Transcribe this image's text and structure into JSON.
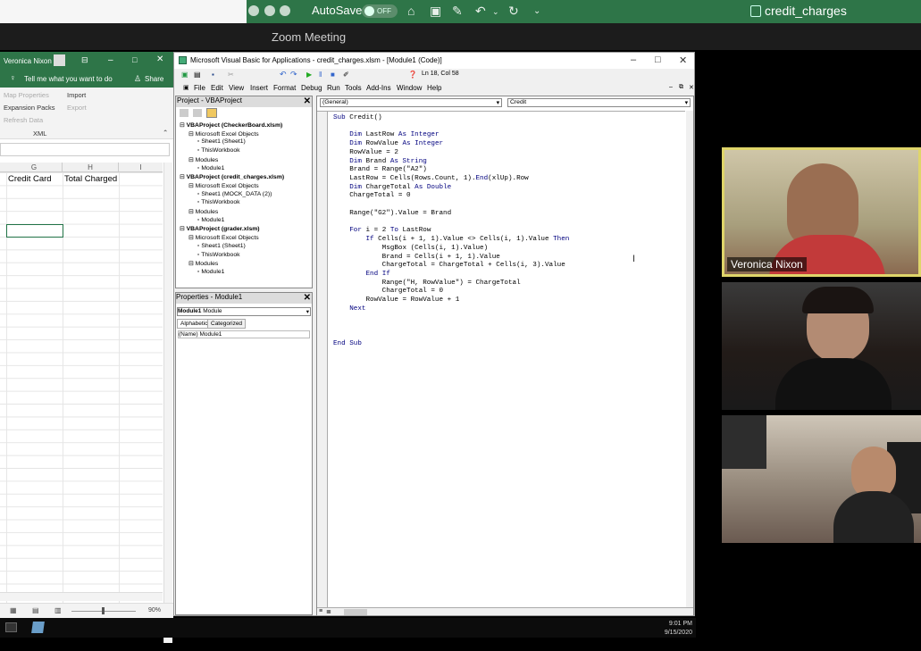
{
  "mac_titlebar": {
    "autosave_label": "AutoSave",
    "autosave_state": "OFF",
    "document_title": "credit_charges",
    "icons": [
      "home-icon",
      "save-icon",
      "edit-icon",
      "undo-icon",
      "chevron-down-icon",
      "redo-icon",
      "more-icon"
    ]
  },
  "zoom": {
    "window_title": "Zoom Meeting"
  },
  "excel": {
    "user_name": "Veronica Nixon",
    "search_hint": "Tell me what you want to do",
    "share_label": "Share",
    "ribbon": {
      "map_properties": "Map Properties",
      "import": "Import",
      "expansion_packs": "Expansion Packs",
      "export": "Export",
      "refresh_data": "Refresh Data",
      "group_label": "XML"
    },
    "columns": [
      "G",
      "H",
      "I"
    ],
    "cells": {
      "g1": "Credit Card",
      "h1": "Total Charged"
    },
    "zoom_level": "90%"
  },
  "vba": {
    "title": "Microsoft Visual Basic for Applications - credit_charges.xlsm - [Module1 (Code)]",
    "cursor_position": "Ln 18, Col 58",
    "menu": [
      "File",
      "Edit",
      "View",
      "Insert",
      "Format",
      "Debug",
      "Run",
      "Tools",
      "Add-Ins",
      "Window",
      "Help"
    ],
    "project_pane_title": "Project - VBAProject",
    "tree": [
      {
        "level": 0,
        "text": "VBAProject (CheckerBoard.xlsm)",
        "bold": true
      },
      {
        "level": 1,
        "text": "Microsoft Excel Objects"
      },
      {
        "level": 2,
        "text": "Sheet1 (Sheet1)"
      },
      {
        "level": 2,
        "text": "ThisWorkbook"
      },
      {
        "level": 1,
        "text": "Modules"
      },
      {
        "level": 2,
        "text": "Module1"
      },
      {
        "level": 0,
        "text": "VBAProject (credit_charges.xlsm)",
        "bold": true
      },
      {
        "level": 1,
        "text": "Microsoft Excel Objects"
      },
      {
        "level": 2,
        "text": "Sheet1 (MOCK_DATA (2))"
      },
      {
        "level": 2,
        "text": "ThisWorkbook"
      },
      {
        "level": 1,
        "text": "Modules"
      },
      {
        "level": 2,
        "text": "Module1"
      },
      {
        "level": 0,
        "text": "VBAProject (grader.xlsm)",
        "bold": true
      },
      {
        "level": 1,
        "text": "Microsoft Excel Objects"
      },
      {
        "level": 2,
        "text": "Sheet1 (Sheet1)"
      },
      {
        "level": 2,
        "text": "ThisWorkbook"
      },
      {
        "level": 1,
        "text": "Modules"
      },
      {
        "level": 2,
        "text": "Module1"
      }
    ],
    "properties": {
      "title": "Properties - Module1",
      "object_bold": "Module1",
      "object_type": "Module",
      "tab_alpha": "Alphabetic",
      "tab_cat": "Categorized",
      "row_name": "(Name)",
      "row_value": "Module1"
    },
    "code_object": "(General)",
    "code_proc": "Credit",
    "code_lines": [
      "Sub Credit()",
      "",
      "    Dim LastRow As Integer",
      "    Dim RowValue As Integer",
      "    RowValue = 2",
      "    Dim Brand As String",
      "    Brand = Range(\"A2\")",
      "    LastRow = Cells(Rows.Count, 1).End(xlUp).Row",
      "    Dim ChargeTotal As Double",
      "    ChargeTotal = 0",
      "",
      "    Range(\"G2\").Value = Brand",
      "",
      "    For i = 2 To LastRow",
      "        If Cells(i + 1, 1).Value <> Cells(i, 1).Value Then",
      "            MsgBox (Cells(i, 1).Value)",
      "            Brand = Cells(i + 1, 1).Value",
      "            ChargeTotal = ChargeTotal + Cells(i, 3).Value",
      "        End If",
      "            Range(\"H, RowValue\") = ChargeTotal",
      "            ChargeTotal = 0",
      "        RowValue = RowValue + 1",
      "    Next",
      "",
      "",
      "",
      "End Sub"
    ]
  },
  "participants": [
    {
      "name": "Veronica Nixon",
      "active": true
    },
    {
      "name": "",
      "active": false
    },
    {
      "name": "",
      "active": false
    }
  ],
  "taskbar": {
    "time": "9:01 PM",
    "date": "9/15/2020"
  }
}
